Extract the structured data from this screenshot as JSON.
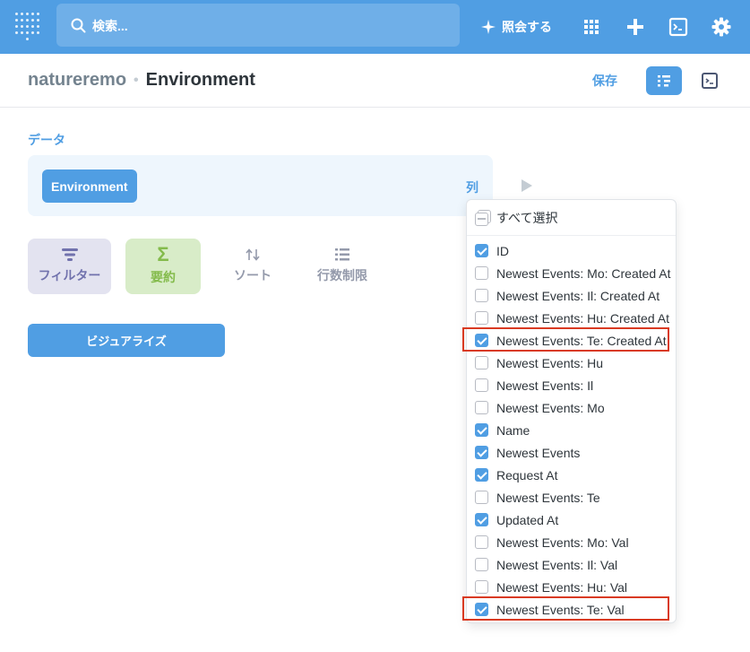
{
  "nav": {
    "search_placeholder": "検索...",
    "ask_label": "照会する",
    "icons": [
      "logo-icon",
      "search-icon",
      "sparkle-icon",
      "grid-icon",
      "plus-icon",
      "terminal-icon",
      "gear-icon"
    ]
  },
  "header": {
    "database": "natureremo",
    "separator": "•",
    "table": "Environment",
    "save_label": "保存"
  },
  "data_section": {
    "label": "データ",
    "table_name": "Environment",
    "columns_label": "列"
  },
  "steps": {
    "filter": "フィルター",
    "summarize": "要約",
    "summarize_symbol": "Σ",
    "sort": "ソート",
    "limit": "行数制限"
  },
  "visualize_label": "ビジュアライズ",
  "columns_popover": {
    "select_all": "すべて選択",
    "items": [
      {
        "label": "ID",
        "checked": true
      },
      {
        "label": "Newest Events: Mo: Created At",
        "checked": false
      },
      {
        "label": "Newest Events: Il: Created At",
        "checked": false
      },
      {
        "label": "Newest Events: Hu: Created At",
        "checked": false
      },
      {
        "label": "Newest Events: Te: Created At",
        "checked": true
      },
      {
        "label": "Newest Events: Hu",
        "checked": false
      },
      {
        "label": "Newest Events: Il",
        "checked": false
      },
      {
        "label": "Newest Events: Mo",
        "checked": false
      },
      {
        "label": "Name",
        "checked": true
      },
      {
        "label": "Newest Events",
        "checked": true
      },
      {
        "label": "Request At",
        "checked": true
      },
      {
        "label": "Newest Events: Te",
        "checked": false
      },
      {
        "label": "Updated At",
        "checked": true
      },
      {
        "label": "Newest Events: Mo: Val",
        "checked": false
      },
      {
        "label": "Newest Events: Il: Val",
        "checked": false
      },
      {
        "label": "Newest Events: Hu: Val",
        "checked": false
      },
      {
        "label": "Newest Events: Te: Val",
        "checked": true
      }
    ]
  },
  "colors": {
    "brand": "#509ee3",
    "filter_bg": "#e3e3f0",
    "summarize_bg": "#d8ecc8",
    "highlight": "#d93a22"
  }
}
